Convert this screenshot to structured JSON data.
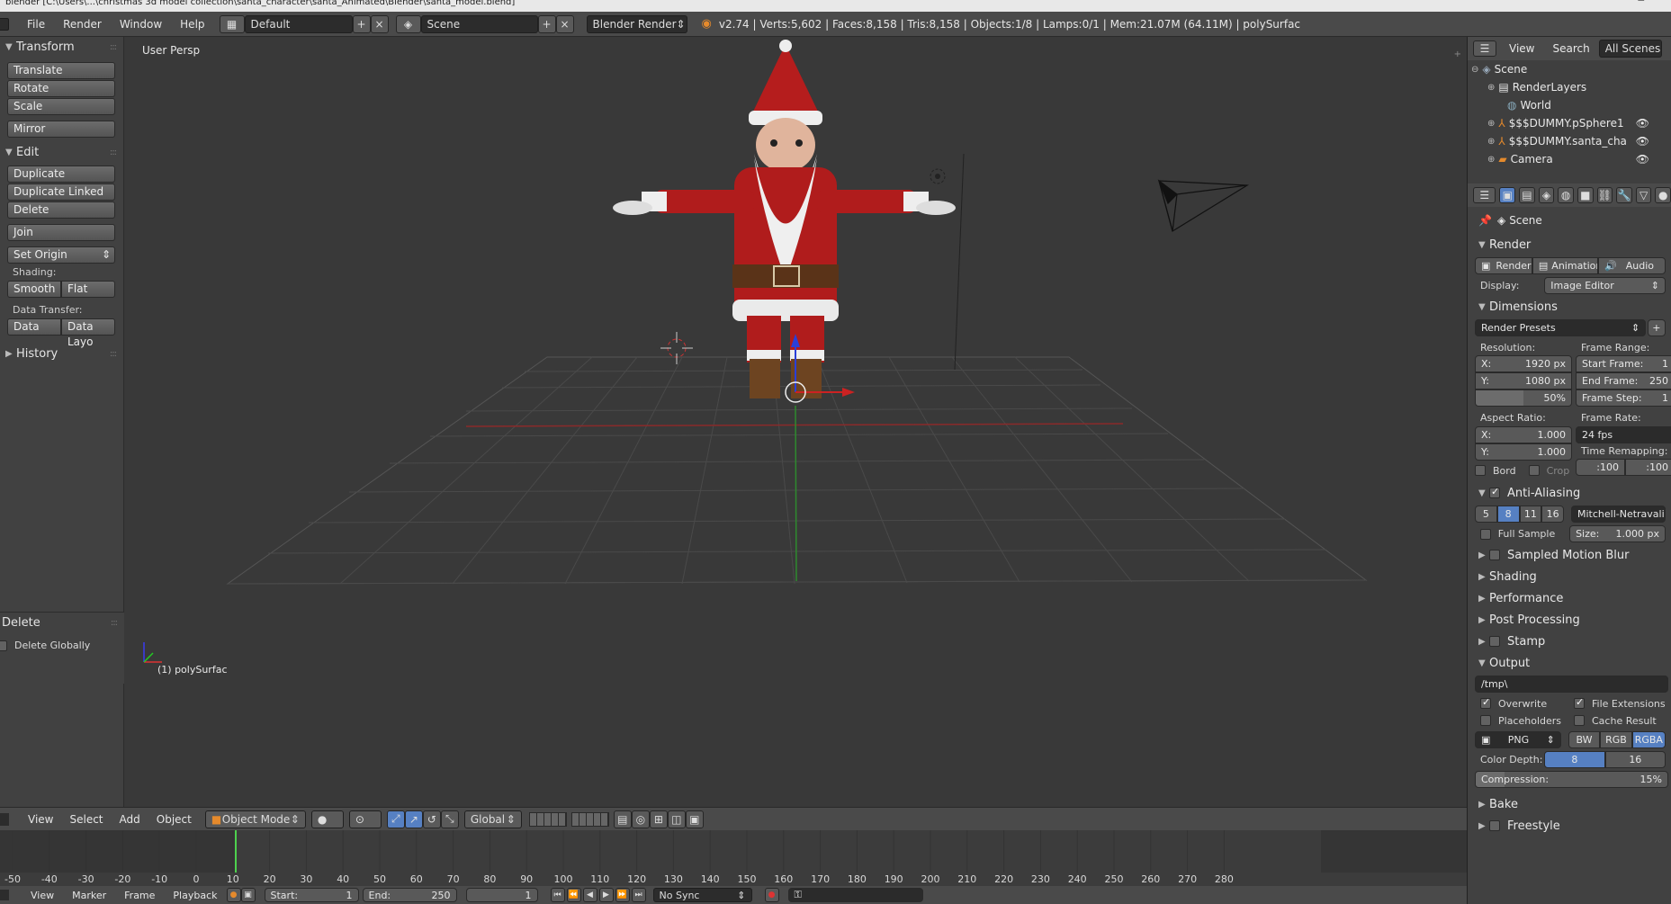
{
  "window_title": "blender [C:\\Users\\...\\christmas 3d model collection\\santa_character\\santa_Animated\\Blender\\santa_model.blend]",
  "topbar": {
    "menus": [
      "File",
      "Render",
      "Window",
      "Help"
    ],
    "screen_layout": "Default",
    "scene": "Scene",
    "engine": "Blender Render",
    "stats": "v2.74 | Verts:5,602 | Faces:8,158 | Tris:8,158 | Objects:1/8 | Lamps:0/1 | Mem:21.07M (64.11M) | polySurfac"
  },
  "toolshelf": {
    "transform_title": "Transform",
    "transform_buttons": [
      "Translate",
      "Rotate",
      "Scale"
    ],
    "mirror": "Mirror",
    "edit_title": "Edit",
    "edit_buttons": [
      "Duplicate",
      "Duplicate Linked",
      "Delete"
    ],
    "join": "Join",
    "set_origin": "Set Origin",
    "shading_label": "Shading:",
    "smooth": "Smooth",
    "flat": "Flat",
    "data_transfer_label": "Data Transfer:",
    "data": "Data",
    "data_layout": "Data Layo",
    "history": "History"
  },
  "operator_panel": {
    "title": "Delete",
    "option": "Delete Globally"
  },
  "viewport": {
    "view_name": "User Persp",
    "active_object": "(1) polySurfac"
  },
  "vp_header": {
    "menus": [
      "View",
      "Select",
      "Add",
      "Object"
    ],
    "mode": "Object Mode",
    "orientation": "Global"
  },
  "timeline": {
    "ticks": [
      "-50",
      "-40",
      "-30",
      "-20",
      "-10",
      "0",
      "10",
      "20",
      "30",
      "40",
      "50",
      "60",
      "70",
      "80",
      "90",
      "100",
      "110",
      "120",
      "130",
      "140",
      "150",
      "160",
      "170",
      "180",
      "190",
      "200",
      "210",
      "220",
      "230",
      "240",
      "250",
      "260",
      "270",
      "280"
    ],
    "menus": [
      "View",
      "Marker",
      "Frame",
      "Playback"
    ],
    "start_label": "Start:",
    "start_value": "1",
    "end_label": "End:",
    "end_value": "250",
    "current": "1",
    "sync": "No Sync"
  },
  "outliner": {
    "view": "View",
    "search": "Search",
    "filter": "All Scenes",
    "items": [
      "Scene",
      "RenderLayers",
      "World",
      "$$$DUMMY.pSphere1",
      "$$$DUMMY.santa_cha",
      "Camera"
    ]
  },
  "properties": {
    "context": "Scene",
    "render_title": "Render",
    "render_btn": "Render",
    "animation_btn": "Animation",
    "audio_btn": "Audio",
    "display_label": "Display:",
    "display_value": "Image Editor",
    "dimensions_title": "Dimensions",
    "render_presets": "Render Presets",
    "resolution_label": "Resolution:",
    "res_x": "X:",
    "res_x_val": "1920 px",
    "res_y": "Y:",
    "res_y_val": "1080 px",
    "res_pct": "50%",
    "frame_range_label": "Frame Range:",
    "start_frame": "Start Frame:",
    "start_frame_val": "1",
    "end_frame": "End Frame:",
    "end_frame_val": "250",
    "frame_step": "Frame Step:",
    "frame_step_val": "1",
    "aspect_label": "Aspect Ratio:",
    "asp_x": "X:",
    "asp_x_val": "1.000",
    "asp_y": "Y:",
    "asp_y_val": "1.000",
    "frame_rate_label": "Frame Rate:",
    "frame_rate": "24 fps",
    "time_remap_label": "Time Remapping:",
    "remap_old": ":100",
    "remap_new": ":100",
    "bord": "Bord",
    "crop": "Crop",
    "aa_title": "Anti-Aliasing",
    "aa_samples": [
      "5",
      "8",
      "11",
      "16"
    ],
    "aa_filter": "Mitchell-Netravali",
    "full_sample": "Full Sample",
    "size_label": "Size:",
    "size_val": "1.000 px",
    "collapsed": [
      "Sampled Motion Blur",
      "Shading",
      "Performance",
      "Post Processing",
      "Stamp"
    ],
    "output_title": "Output",
    "output_path": "/tmp\\",
    "overwrite": "Overwrite",
    "file_ext": "File Extensions",
    "placeholders": "Placeholders",
    "cache_result": "Cache Result",
    "format": "PNG",
    "bw": "BW",
    "rgb": "RGB",
    "rgba": "RGBA",
    "color_depth_label": "Color Depth:",
    "depth_8": "8",
    "depth_16": "16",
    "compression_label": "Compression:",
    "compression_val": "15%",
    "bake": "Bake",
    "freestyle": "Freestyle"
  }
}
